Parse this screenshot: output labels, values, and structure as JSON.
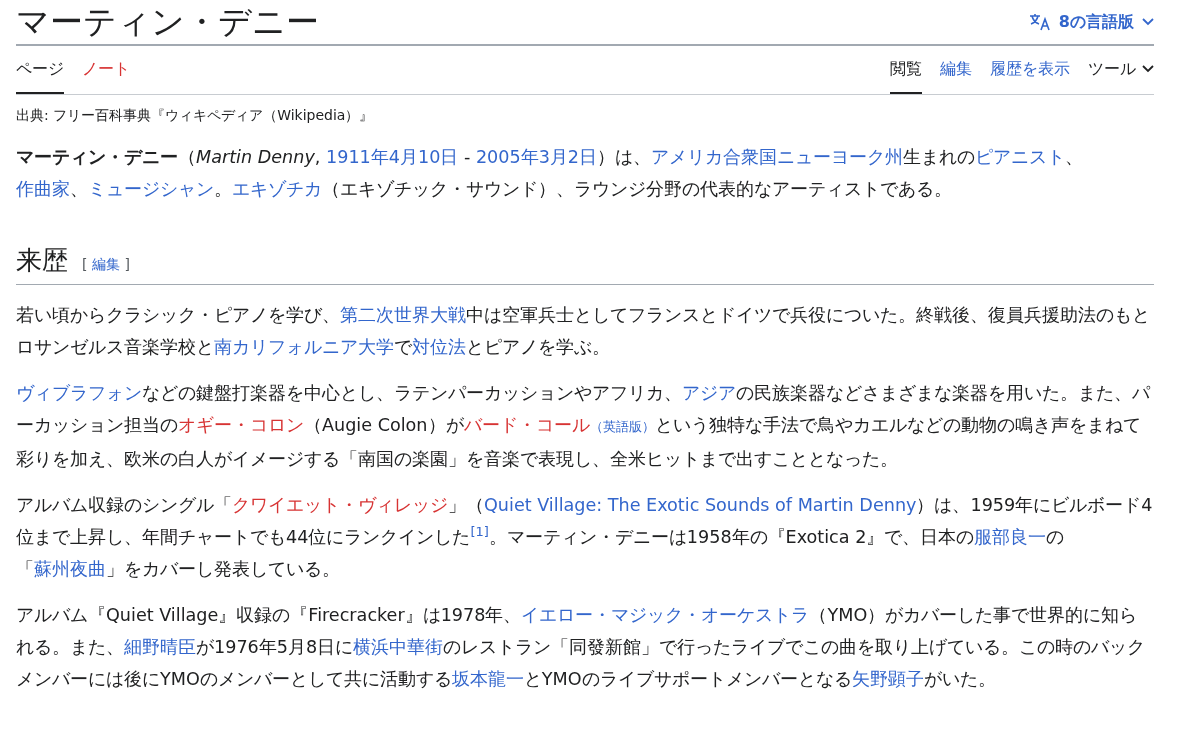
{
  "title": "マーティン・デニー",
  "language_button": {
    "label": "8の言語版"
  },
  "left_tabs": [
    {
      "label": "ページ",
      "selected": true,
      "kind": "normal"
    },
    {
      "label": "ノート",
      "selected": false,
      "kind": "redlink"
    }
  ],
  "right_tabs": [
    {
      "label": "閲覧",
      "selected": true,
      "kind": "normal"
    },
    {
      "label": "編集",
      "selected": false,
      "kind": "normal"
    },
    {
      "label": "履歴を表示",
      "selected": false,
      "kind": "normal"
    },
    {
      "label": "ツール",
      "selected": false,
      "kind": "menu"
    }
  ],
  "site_sub": "出典: フリー百科事典『ウィキペディア（Wikipedia）』",
  "intro": [
    [
      {
        "kind": "bold",
        "text": "マーティン・デニー"
      },
      {
        "kind": "text",
        "text": "（"
      },
      {
        "kind": "italic",
        "text": "Martin Denny"
      },
      {
        "kind": "text",
        "text": ", "
      },
      {
        "kind": "link",
        "text": "1911年4月10日"
      },
      {
        "kind": "text",
        "text": " - "
      },
      {
        "kind": "link",
        "text": "2005年3月2日"
      },
      {
        "kind": "text",
        "text": "）は、"
      },
      {
        "kind": "link",
        "text": "アメリカ合衆国"
      },
      {
        "kind": "link",
        "text": "ニューヨーク州"
      },
      {
        "kind": "text",
        "text": "生まれの"
      },
      {
        "kind": "link",
        "text": "ピアニスト"
      },
      {
        "kind": "text",
        "text": "、"
      },
      {
        "kind": "link",
        "text": "作曲家"
      },
      {
        "kind": "text",
        "text": "、"
      },
      {
        "kind": "link",
        "text": "ミュージシャン"
      },
      {
        "kind": "text",
        "text": "。"
      },
      {
        "kind": "link",
        "text": "エキゾチカ"
      },
      {
        "kind": "text",
        "text": "（エキゾチック・サウンド）、ラウンジ分野の代表的なアーティストである。"
      }
    ]
  ],
  "section": {
    "heading": "来歴",
    "edit_link": {
      "open": "[",
      "label": "編集",
      "close": "]"
    },
    "paragraphs": [
      [
        {
          "kind": "text",
          "text": "若い頃からクラシック・ピアノを学び、"
        },
        {
          "kind": "link",
          "text": "第二次世界大戦"
        },
        {
          "kind": "text",
          "text": "中は空軍兵士としてフランスとドイツで兵役についた。終戦後、復員兵援助法のもとロサンゼルス音楽学校と"
        },
        {
          "kind": "link",
          "text": "南カリフォルニア大学"
        },
        {
          "kind": "text",
          "text": "で"
        },
        {
          "kind": "link",
          "text": "対位法"
        },
        {
          "kind": "text",
          "text": "とピアノを学ぶ。"
        }
      ],
      [
        {
          "kind": "link",
          "text": "ヴィブラフォン"
        },
        {
          "kind": "text",
          "text": "などの鍵盤打楽器を中心とし、ラテンパーカッションやアフリカ、"
        },
        {
          "kind": "link",
          "text": "アジア"
        },
        {
          "kind": "text",
          "text": "の民族楽器などさまざまな楽器を用いた。また、パーカッション担当の"
        },
        {
          "kind": "redlink",
          "text": "オギー・コロン"
        },
        {
          "kind": "text",
          "text": "（Augie Colon）が"
        },
        {
          "kind": "redlink",
          "text": "バード・コール"
        },
        {
          "kind": "small_link",
          "text": "（英語版）"
        },
        {
          "kind": "text",
          "text": "という独特な手法で鳥やカエルなどの動物の鳴き声をまねて彩りを加え、欧米の白人がイメージする「南国の楽園」を音楽で表現し、全米ヒットまで出すこととなった。"
        }
      ],
      [
        {
          "kind": "text",
          "text": "アルバム収録のシングル「"
        },
        {
          "kind": "redlink",
          "text": "クワイエット・ヴィレッジ"
        },
        {
          "kind": "text",
          "text": "」（"
        },
        {
          "kind": "link",
          "text": "Quiet Village: The Exotic Sounds of Martin Denny"
        },
        {
          "kind": "text",
          "text": "）は、1959年にビルボード4位まで上昇し、年間チャートでも44位にランクインした"
        },
        {
          "kind": "ref",
          "text": "[1]"
        },
        {
          "kind": "text",
          "text": "。マーティン・デニーは1958年の『Exotica 2』で、日本の"
        },
        {
          "kind": "link",
          "text": "服部良一"
        },
        {
          "kind": "text",
          "text": "の「"
        },
        {
          "kind": "link",
          "text": "蘇州夜曲"
        },
        {
          "kind": "text",
          "text": "」をカバーし発表している。"
        }
      ],
      [
        {
          "kind": "text",
          "text": "アルバム『Quiet Village』収録の『Firecracker』は1978年、"
        },
        {
          "kind": "link",
          "text": "イエロー・マジック・オーケストラ"
        },
        {
          "kind": "text",
          "text": "（YMO）がカバーした事で世界的に知られる。また、"
        },
        {
          "kind": "link",
          "text": "細野晴臣"
        },
        {
          "kind": "text",
          "text": "が1976年5月8日に"
        },
        {
          "kind": "link",
          "text": "横浜中華街"
        },
        {
          "kind": "text",
          "text": "のレストラン「同發新館」で行ったライブでこの曲を取り上げている。この時のバックメンバーには後にYMOのメンバーとして共に活動する"
        },
        {
          "kind": "link",
          "text": "坂本龍一"
        },
        {
          "kind": "text",
          "text": "とYMOのライブサポートメンバーとなる"
        },
        {
          "kind": "link",
          "text": "矢野顕子"
        },
        {
          "kind": "text",
          "text": "がいた。"
        }
      ]
    ]
  }
}
